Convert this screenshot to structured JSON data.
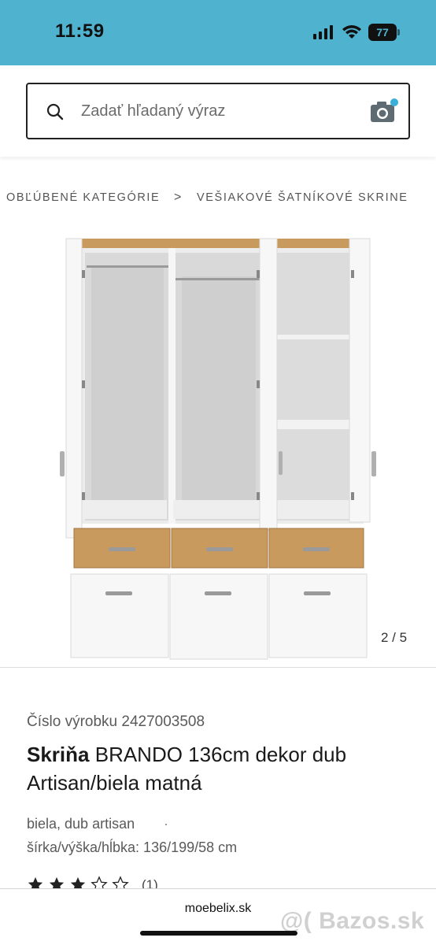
{
  "status_bar": {
    "time": "11:59",
    "battery_percent": "77",
    "icons": [
      "cellular-signal-icon",
      "wifi-icon",
      "battery-icon"
    ]
  },
  "search": {
    "placeholder": "Zadať hľadaný výraz",
    "icons": [
      "search-icon",
      "camera-icon"
    ]
  },
  "breadcrumb": {
    "items": [
      "OBĽÚBENÉ KATEGÓRIE",
      "VEŠIAKOVÉ ŠATNÍKOVÉ SKRINE"
    ],
    "separator": ">"
  },
  "gallery": {
    "counter": "2 / 5",
    "current": 2,
    "total": 5
  },
  "product": {
    "number": "Číslo výrobku 2427003508",
    "title_bold": "Skriňa",
    "title_rest": " BRANDO 136cm dekor dub Artisan/biela matná",
    "color": "biela, dub artisan",
    "color_dot": "·",
    "dimensions": "šírka/výška/hĺbka: 136/199/58 cm",
    "rating": 3,
    "rating_max": 5,
    "rating_count": "(1)"
  },
  "browser": {
    "url": "moebelix.sk",
    "watermark": "@( Bazos.sk"
  },
  "colors": {
    "status_bar": "#4fb3cf",
    "camera_badge": "#3ab0d8",
    "oak": "#c99a5e",
    "white_panel": "#f4f4f4"
  }
}
